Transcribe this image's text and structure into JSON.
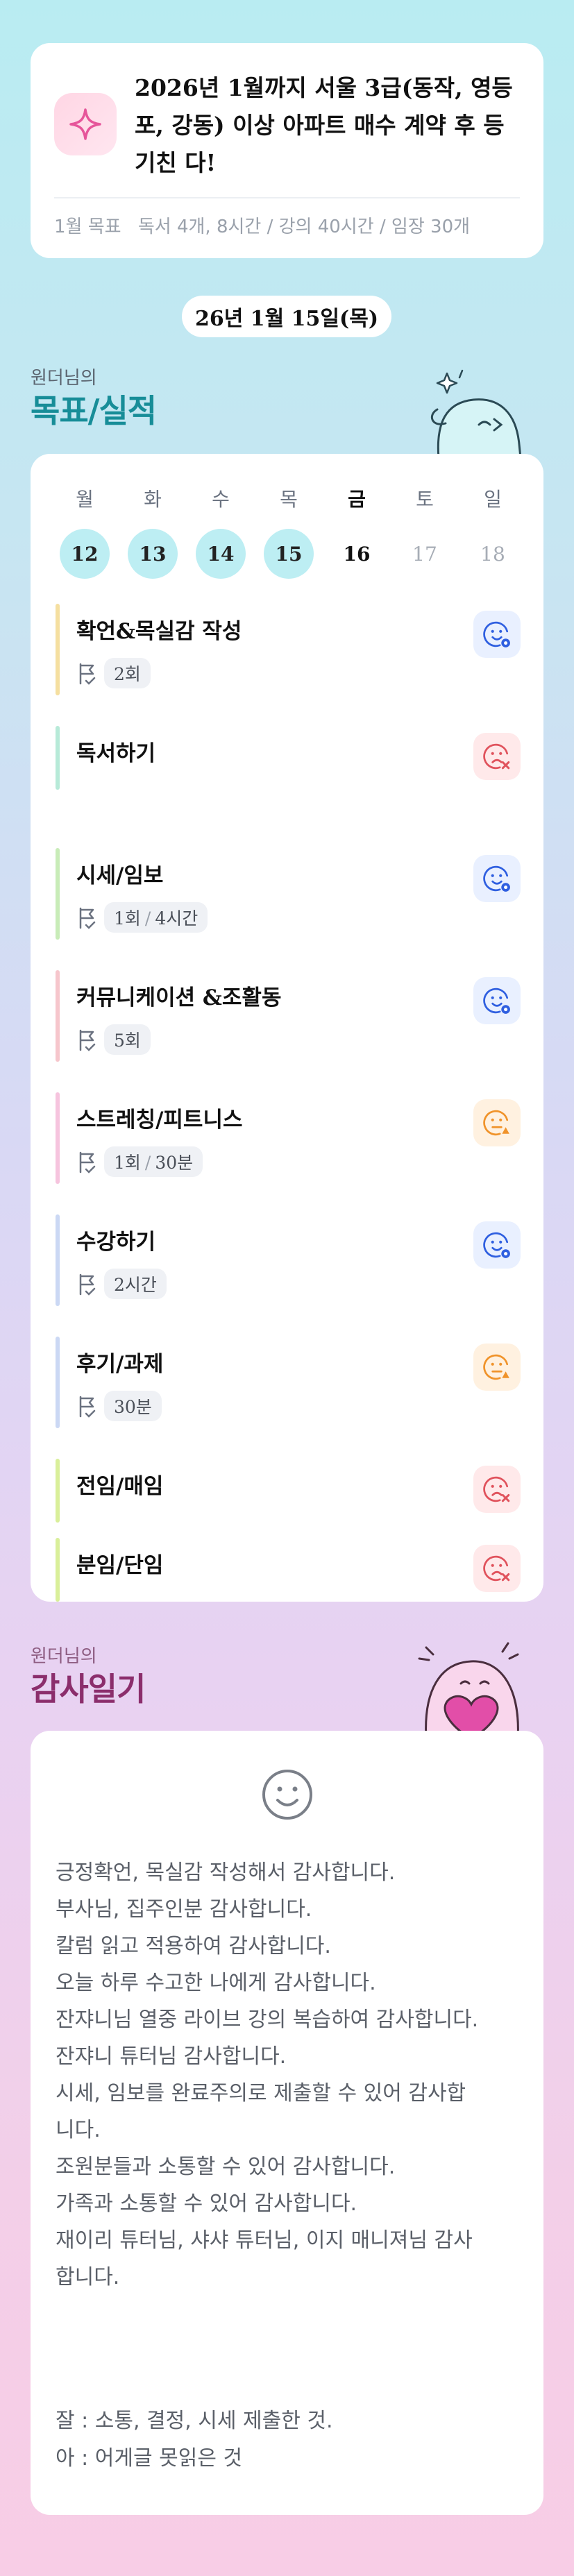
{
  "goal": {
    "title": "2026년 1월까지 서울 3급(동작, 영등포, 강동) 이상 아파트 매수 계약 후 등기친 다!",
    "label": "1월 목표",
    "details": "독서 4개, 8시간 / 강의 40시간 / 임장 30개"
  },
  "date": "26년 1월 15일(목)",
  "goals_section": {
    "subtitle": "원더님의",
    "title": "목표/실적"
  },
  "week": {
    "days": [
      "월",
      "화",
      "수",
      "목",
      "금",
      "토",
      "일"
    ],
    "dates": [
      "12",
      "13",
      "14",
      "15",
      "16",
      "17",
      "18"
    ],
    "states": [
      "done",
      "done",
      "done",
      "done",
      "today",
      "future",
      "future"
    ]
  },
  "tasks": [
    {
      "name": "확언&목실감 작성",
      "count": "2회",
      "time": "",
      "bar": "#f5dfa0",
      "status": "blue"
    },
    {
      "name": "독서하기",
      "count": "",
      "time": "",
      "bar": "#b7ead8",
      "status": "red"
    },
    {
      "name": "시세/임보",
      "count": "1회",
      "time": "4시간",
      "bar": "#c8ecb8",
      "status": "blue"
    },
    {
      "name": "커뮤니케이션 &조활동",
      "count": "5회",
      "time": "",
      "bar": "#f6c6cc",
      "status": "blue"
    },
    {
      "name": "스트레칭/피트니스",
      "count": "1회",
      "time": "30분",
      "bar": "#f6c4de",
      "status": "orange"
    },
    {
      "name": "수강하기",
      "count": "2시간",
      "time": "",
      "bar": "#cbd8f4",
      "status": "blue"
    },
    {
      "name": "후기/과제",
      "count": "30분",
      "time": "",
      "bar": "#cbd8f4",
      "status": "orange"
    },
    {
      "name": "전임/매임",
      "count": "",
      "time": "",
      "bar": "#d9ef9a",
      "status": "red"
    },
    {
      "name": "분임/단임",
      "count": "",
      "time": "",
      "bar": "#d9ef9a",
      "status": "red"
    }
  ],
  "gratitude_section": {
    "subtitle": "원더님의",
    "title": "감사일기"
  },
  "gratitude": {
    "lines": [
      "긍정확언, 목실감 작성해서 감사합니다.",
      "부사님, 집주인분 감사합니다.",
      "칼럼 읽고 적용하여 감사합니다.",
      "오늘 하루 수고한 나에게 감사합니다.",
      "잔쟈니님 열중 라이브 강의 복습하여 감사합니다.",
      "잔쟈니 튜터님 감사합니다.",
      "시세, 임보를 완료주의로 제출할 수 있어 감사합",
      "니다.",
      "조원분들과 소통할 수 있어 감사합니다.",
      "가족과 소통할 수 있어 감사합니다.",
      "재이리 튜터님, 샤샤 튜터님, 이지 매니져님 감사",
      "합니다."
    ],
    "review": [
      "잘 : 소통, 결정, 시세 제출한 것.",
      "아 : 어게글 못읽은 것"
    ]
  },
  "colors": {
    "accent_teal": "#178d98",
    "accent_plum": "#8b2e6c",
    "status_blue": "#2f5fe0",
    "status_red": "#e0525c",
    "status_orange": "#f0932a"
  }
}
